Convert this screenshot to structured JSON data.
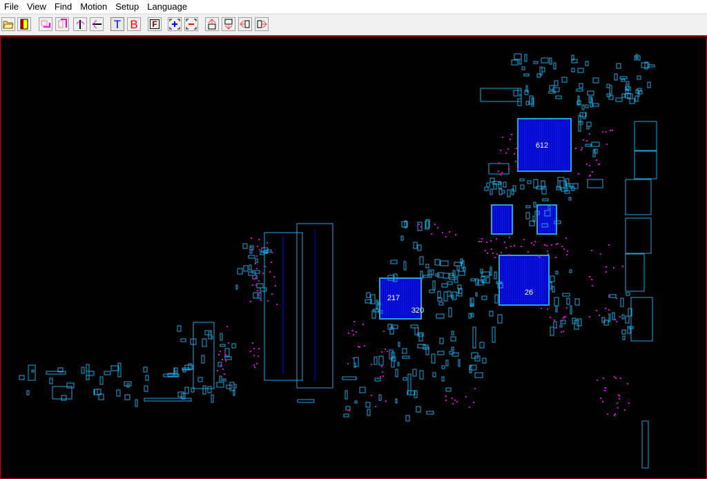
{
  "menu": [
    "File",
    "View",
    "Find",
    "Motion",
    "Setup",
    "Language"
  ],
  "toolbar": [
    {
      "name": "open-file-button",
      "icon": "folder-open-icon"
    },
    {
      "name": "exit-button",
      "icon": "door-exit-icon"
    },
    {
      "name": "rotate-flip-button",
      "icon": "rotate-icon"
    },
    {
      "name": "mirror-button",
      "icon": "mirror-icon"
    },
    {
      "name": "flip-vertical-button",
      "icon": "flip-vertical-icon"
    },
    {
      "name": "flip-horizontal-button",
      "icon": "flip-horizontal-icon"
    },
    {
      "name": "top-side-button",
      "label": "T",
      "color": "#0000ff",
      "pressed": true
    },
    {
      "name": "bottom-side-button",
      "label": "B",
      "color": "#ff0000"
    },
    {
      "name": "frame-button",
      "label": "F",
      "color": "#800000"
    },
    {
      "name": "zoom-fit-button",
      "icon": "zoom-fit-icon"
    },
    {
      "name": "zoom-out-button",
      "icon": "zoom-out-icon"
    },
    {
      "name": "move-up-button",
      "icon": "arrow-up-icon"
    },
    {
      "name": "move-down-button",
      "icon": "arrow-down-icon"
    },
    {
      "name": "move-left-button",
      "icon": "arrow-left-icon"
    },
    {
      "name": "move-right-button",
      "icon": "arrow-right-icon"
    }
  ],
  "board": {
    "chip_labels": [
      "612",
      "26",
      "217",
      "320"
    ],
    "colors": {
      "outline": "#1ea8e0",
      "fill": "#0000c8",
      "pin": "#e000e0",
      "border": "#c00000",
      "background": "#000000"
    }
  }
}
